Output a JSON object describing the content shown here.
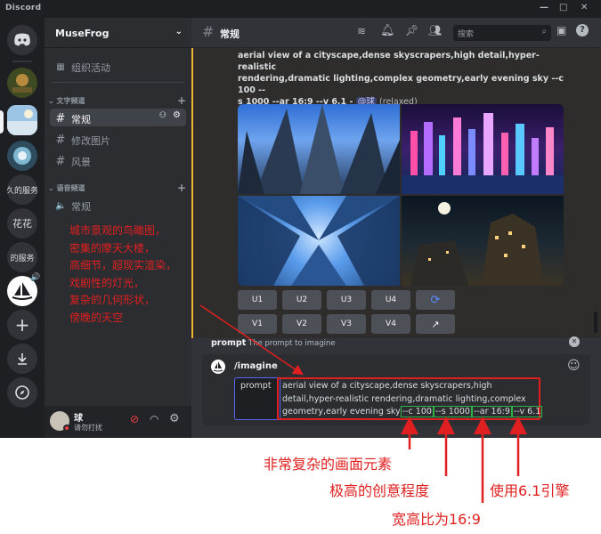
{
  "titlebar": {
    "app": "Discord",
    "minimize": "—",
    "maximize": "□",
    "close": "✕"
  },
  "server_rail": {
    "servers": [
      {
        "name": "discord-home"
      },
      {
        "name": "server-avatar-1"
      },
      {
        "name": "server-avatar-2"
      },
      {
        "name": "server-avatar-3"
      },
      {
        "label": "久的服务"
      },
      {
        "label": "花花"
      },
      {
        "label": "的服务"
      },
      {
        "name": "midjourney-server"
      }
    ]
  },
  "channels": {
    "server_name": "MuseFrog",
    "events_label": "组织活动",
    "text_category": "文字频道",
    "text_channels": [
      "常规",
      "修改图片",
      "风景"
    ],
    "voice_category": "语音频道",
    "voice_channels": [
      "常规"
    ]
  },
  "user": {
    "name": "球",
    "status": "请勿打扰"
  },
  "header": {
    "channel": "常规",
    "search_placeholder": "搜索"
  },
  "message": {
    "prompt_line1": "aerial view of a cityscape,dense skyscrapers,high detail,hyper-realistic",
    "prompt_line2": "rendering,dramatic lighting,complex geometry,early evening sky --c 100 --",
    "prompt_line3": "s 1000 --ar 16:9 --v 6.1 -",
    "mention": "@球",
    "mode": "(relaxed)",
    "upscale_buttons": [
      "U1",
      "U2",
      "U3",
      "U4"
    ],
    "variation_buttons": [
      "V1",
      "V2",
      "V3",
      "V4"
    ]
  },
  "command": {
    "param_name": "prompt",
    "param_desc": "The prompt to imagine",
    "name": "/imagine",
    "field_label": "prompt",
    "text_line1": "aerial view of a cityscape,dense skyscrapers,high",
    "text_line2": "detail,hyper-realistic rendering,dramatic lighting,complex",
    "text_line3": "geometry,early evening sky",
    "param_c": "--c 100",
    "param_s": "--s 1000",
    "param_ar": "--ar 16:9",
    "param_v": "--v 6.1"
  },
  "annotations": {
    "description": [
      "城市景观的鸟瞰图，",
      "密集的摩天大楼，",
      "高细节，超现实渲染，",
      "戏剧性的灯光，",
      "复杂的几何形状，",
      "傍晚的天空"
    ],
    "chaos": "非常复杂的画面元素",
    "stylize": "极高的创意程度",
    "aspect": "宽高比为16:9",
    "version": "使用6.1引擎"
  },
  "colors": {
    "accent": "#5865f2",
    "annotation": "#e02020",
    "param_box": "#2fb344",
    "prompt_box": "#e02020",
    "mention_bg": "#3c4270"
  }
}
